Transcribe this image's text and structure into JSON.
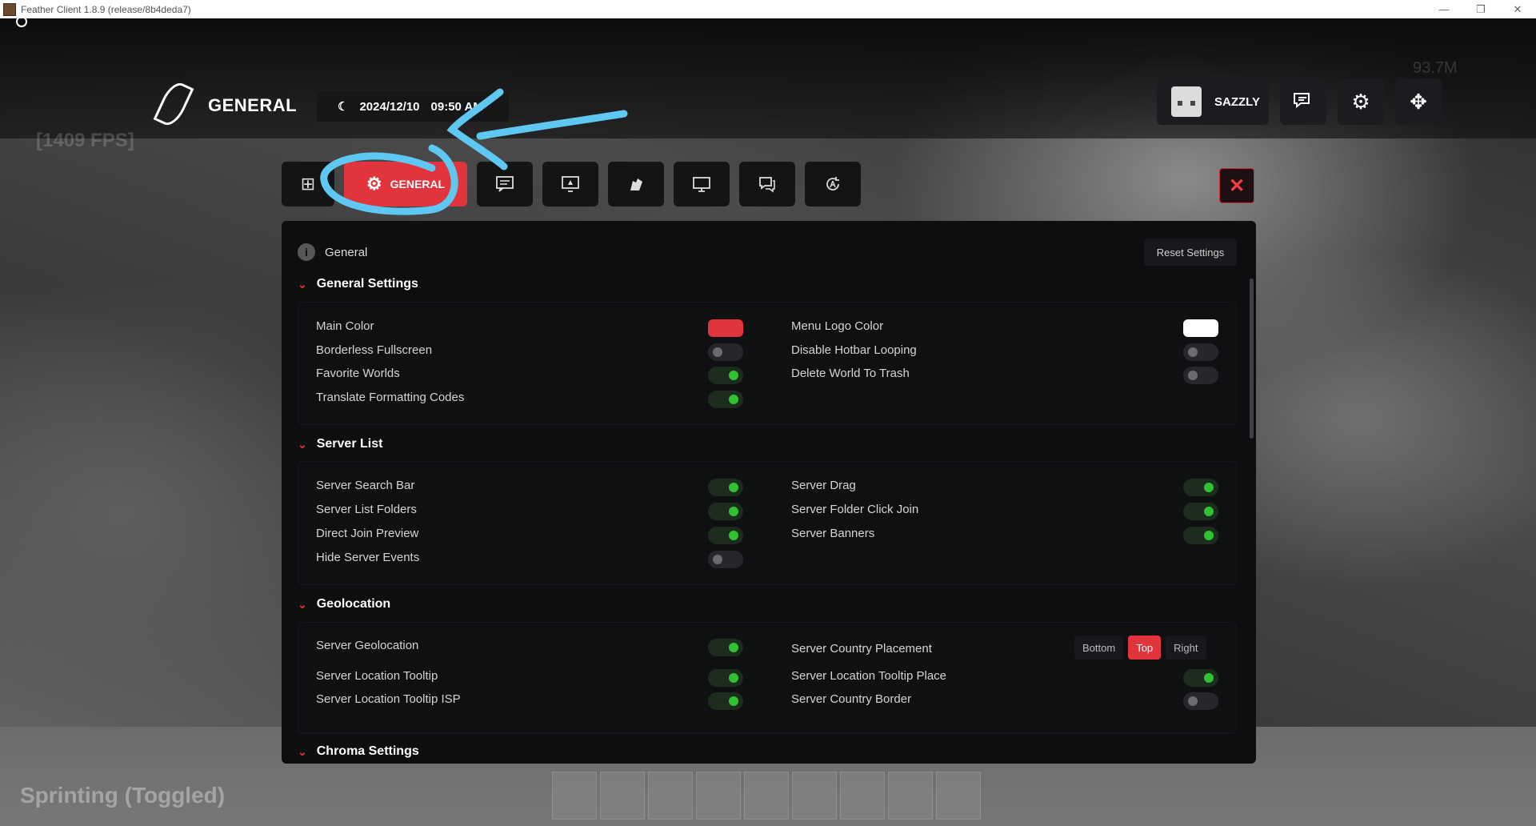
{
  "window": {
    "title": "Feather Client 1.8.9 (release/8b4deda7)",
    "minimize": "—",
    "maximize": "❐",
    "close": "✕"
  },
  "hud": {
    "fps": "[1409 FPS]",
    "status": "Sprinting (Toggled)",
    "coords": "93.7M"
  },
  "header": {
    "title": "GENERAL",
    "date": "2024/12/10",
    "time": "09:50 AM",
    "user_name": "SAZZLY"
  },
  "tabs": {
    "active_label": "GENERAL",
    "icons": [
      "grid-icon",
      "gear-icon",
      "chat-icon",
      "monitor-cursor-icon",
      "hand-icon",
      "display-icon",
      "messages-icon",
      "rotate-icon"
    ]
  },
  "panel": {
    "heading": "General",
    "reset_label": "Reset Settings"
  },
  "colors": {
    "accent": "#e1343c",
    "toggle_on": "#2fc332",
    "main_color": "#e1343c",
    "menu_logo_color": "#ffffff"
  },
  "sections": {
    "general": {
      "title": "General Settings",
      "main_color": "Main Color",
      "borderless": "Borderless Fullscreen",
      "favorite": "Favorite Worlds",
      "translate": "Translate Formatting Codes",
      "menu_logo": "Menu Logo Color",
      "hotbar": "Disable Hotbar Looping",
      "trash": "Delete World To Trash",
      "values": {
        "borderless": false,
        "favorite": true,
        "translate": true,
        "hotbar": false,
        "trash": false
      }
    },
    "server_list": {
      "title": "Server List",
      "search_bar": "Server Search Bar",
      "folders": "Server List Folders",
      "direct_join": "Direct Join Preview",
      "hide_events": "Hide Server Events",
      "drag": "Server Drag",
      "folder_click": "Server Folder Click Join",
      "banners": "Server Banners",
      "values": {
        "search_bar": true,
        "folders": true,
        "direct_join": true,
        "hide_events": false,
        "drag": true,
        "folder_click": true,
        "banners": true
      }
    },
    "geolocation": {
      "title": "Geolocation",
      "geo": "Server Geolocation",
      "tooltip": "Server Location Tooltip",
      "tooltip_isp": "Server Location Tooltip ISP",
      "placement": "Server Country Placement",
      "tooltip_place": "Server Location Tooltip Place",
      "border": "Server Country Border",
      "placement_options": [
        "Bottom",
        "Top",
        "Right"
      ],
      "placement_selected": "Top",
      "values": {
        "geo": true,
        "tooltip": true,
        "tooltip_isp": true,
        "tooltip_place": true,
        "border": false
      }
    },
    "chroma": {
      "title": "Chroma Settings"
    }
  }
}
